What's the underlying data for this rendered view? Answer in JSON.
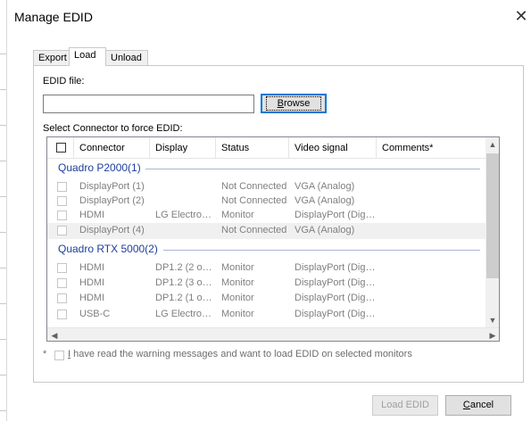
{
  "window": {
    "title": "Manage EDID"
  },
  "tabs": [
    {
      "label": "Export"
    },
    {
      "label": "Load"
    },
    {
      "label": "Unload"
    }
  ],
  "edid_file": {
    "label": "EDID file:",
    "value": "",
    "browse_prefix": "",
    "browse_underlined": "B",
    "browse_rest": "rowse"
  },
  "connector_section": {
    "label": "Select Connector to force EDID:"
  },
  "columns": [
    "Connector",
    "Display",
    "Status",
    "Video signal",
    "Comments*"
  ],
  "groups": [
    {
      "name": "Quadro P2000(1)",
      "rows": [
        {
          "connector": "DisplayPort (1)",
          "display": "",
          "status": "Not Connected",
          "video": "VGA (Analog)",
          "highlighted": false
        },
        {
          "connector": "DisplayPort (2)",
          "display": "",
          "status": "Not Connected",
          "video": "VGA (Analog)",
          "highlighted": false
        },
        {
          "connector": "HDMI",
          "display": "LG Electro…",
          "status": "Monitor",
          "video": "DisplayPort (Dig…",
          "highlighted": false
        },
        {
          "connector": "DisplayPort (4)",
          "display": "",
          "status": "Not Connected",
          "video": "VGA (Analog)",
          "highlighted": true
        }
      ]
    },
    {
      "name": "Quadro RTX 5000(2)",
      "rows": [
        {
          "connector": "HDMI",
          "display": "DP1.2 (2 o…",
          "status": "Monitor",
          "video": "DisplayPort (Dig…",
          "highlighted": false
        },
        {
          "connector": "HDMI",
          "display": "DP1.2 (3 o…",
          "status": "Monitor",
          "video": "DisplayPort (Dig…",
          "highlighted": false
        },
        {
          "connector": "HDMI",
          "display": "DP1.2 (1 o…",
          "status": "Monitor",
          "video": "DisplayPort (Dig…",
          "highlighted": false
        },
        {
          "connector": "USB-C",
          "display": "LG Electro…",
          "status": "Monitor",
          "video": "DisplayPort (Dig…",
          "highlighted": false
        }
      ]
    }
  ],
  "warning": {
    "asterisk": "*",
    "accel": "I",
    "text": " have read the warning messages and want to load EDID on selected monitors"
  },
  "buttons": {
    "load_edid": "Load EDID",
    "cancel_accel": "C",
    "cancel_rest": "ancel"
  },
  "icons": {
    "close": "close-icon",
    "scroll_up": "chevron-up-icon",
    "scroll_down": "chevron-down-icon",
    "scroll_left": "chevron-left-icon",
    "scroll_right": "chevron-right-icon"
  },
  "colors": {
    "group_header": "#1e3d9c",
    "accent": "#0078d7"
  }
}
